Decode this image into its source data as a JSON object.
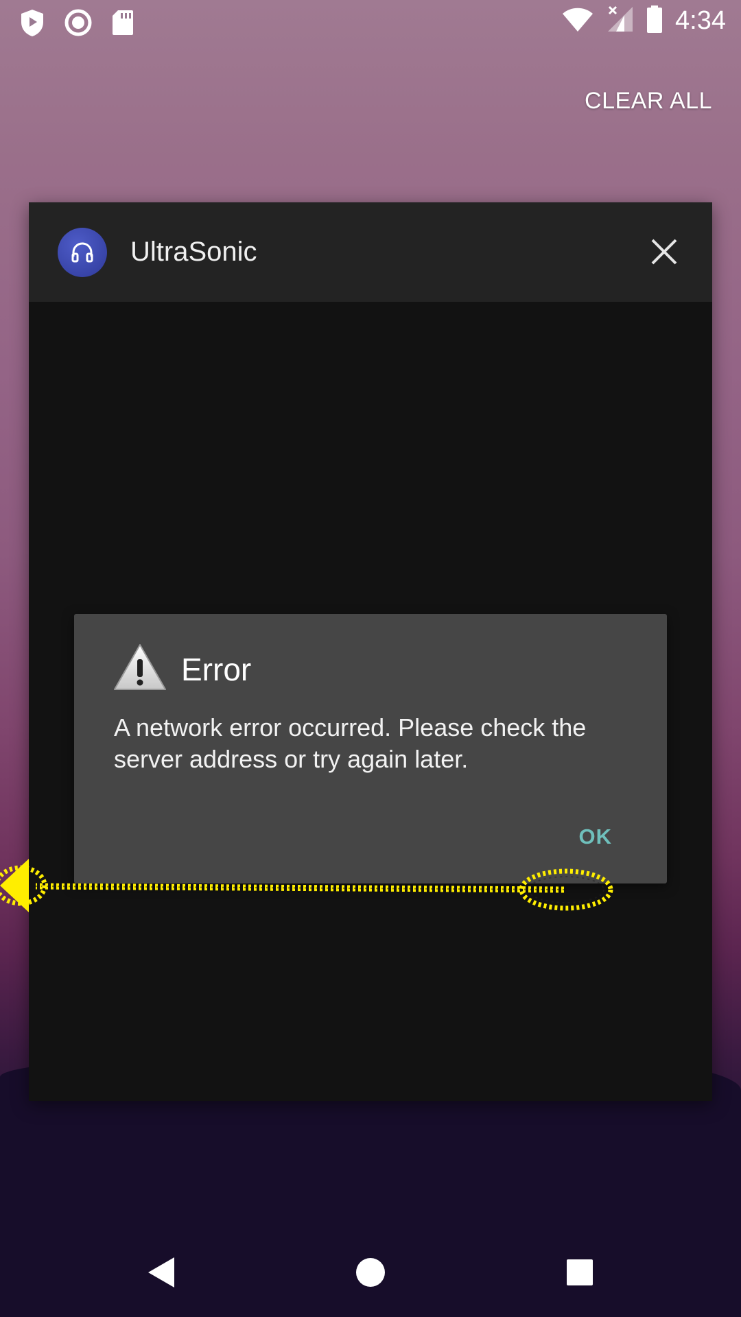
{
  "status_bar": {
    "time": "4:34",
    "icons_left": [
      "play-protect-icon",
      "record-icon",
      "sd-card-icon"
    ],
    "icons_right": [
      "wifi-icon",
      "cellular-no-data-icon",
      "battery-icon"
    ]
  },
  "recents": {
    "clear_all_label": "CLEAR ALL"
  },
  "app_card": {
    "title": "UltraSonic",
    "icon": "headphones-icon",
    "close_icon": "close-icon"
  },
  "dialog": {
    "title": "Error",
    "icon": "warning-icon",
    "message": "A network error occurred. Please check the server address or try again later.",
    "ok_label": "OK",
    "accent_color": "#6fc0bc"
  },
  "annotation": {
    "type": "swipe-left-gesture",
    "color": "#ffee00"
  },
  "nav_bar": {
    "buttons": [
      "back-icon",
      "home-icon",
      "recents-icon"
    ]
  }
}
